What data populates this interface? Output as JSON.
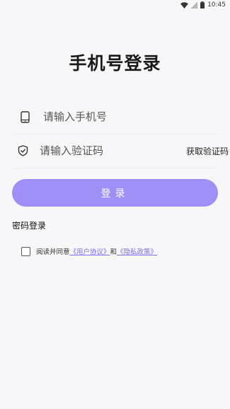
{
  "status_bar": {
    "time": "10:45"
  },
  "page_title": "手机号登录",
  "phone_field": {
    "placeholder": "请输入手机号",
    "icon": "phone-icon"
  },
  "code_field": {
    "placeholder": "请输入验证码",
    "icon": "shield-check-icon",
    "get_code_label": "获取验证码"
  },
  "login_button": {
    "label": "登录"
  },
  "password_login_label": "密码登录",
  "agreement": {
    "prefix": "阅读并同意",
    "user_agreement": "《用户协议》",
    "conjunction": "和",
    "privacy_policy": "《隐私政策》"
  },
  "colors": {
    "accent": "#9d8ff5",
    "link": "#7b6ee6",
    "background": "#f7f7f9"
  }
}
